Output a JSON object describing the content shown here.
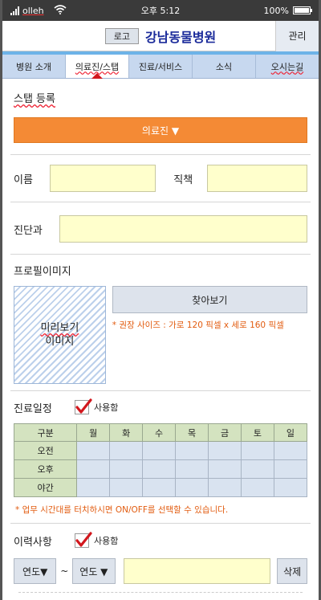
{
  "status_bar": {
    "carrier": "olleh",
    "time": "오후  5:12",
    "battery": "100%",
    "battery_level": 1.0,
    "icons": [
      "signal-icon",
      "wifi-icon",
      "battery-icon"
    ]
  },
  "header": {
    "logo": "로고",
    "title": "강남동물병원",
    "admin_button": "관리"
  },
  "tabs": [
    {
      "label": "병원 소개",
      "active": false
    },
    {
      "label": "의료진/스탭",
      "active": true
    },
    {
      "label": "진료/서비스",
      "active": false
    },
    {
      "label": "소식",
      "active": false
    },
    {
      "label": "오시는길",
      "active": false
    }
  ],
  "staff_register": {
    "title": "스탭 등록",
    "type_select": "의료진 ▼"
  },
  "form": {
    "name_label": "이름",
    "name_value": "",
    "position_label": "직책",
    "position_value": "",
    "department_label": "진단과",
    "department_value": ""
  },
  "profile_image": {
    "title": "프로필이미지",
    "preview_line1": "미리보기",
    "preview_line2": "이미지",
    "browse_button": "찾아보기",
    "size_note": "* 권장 사이즈 : 가로 120 픽셀 x 세로 160 픽셀"
  },
  "schedule": {
    "title": "진료일정",
    "use_label": "사용함",
    "use_checked": true,
    "headers": [
      "구분",
      "월",
      "화",
      "수",
      "목",
      "금",
      "토",
      "일"
    ],
    "rows": [
      "오전",
      "오후",
      "야간"
    ],
    "note": "* 업무 시간대를 터치하시면  ON/OFF를 선택할 수 있습니다."
  },
  "career": {
    "title": "이력사항",
    "use_label": "사용함",
    "use_checked": true,
    "from_select": "연도▼",
    "tilde": "~",
    "to_select": "연도 ▼",
    "delete_button": "삭제"
  },
  "colors": {
    "accent_orange": "#f48a35",
    "title_blue": "#1a2a9a",
    "input_yellow": "#ffffcc",
    "note_orange": "#e25c10",
    "check_red": "#d2171d"
  }
}
